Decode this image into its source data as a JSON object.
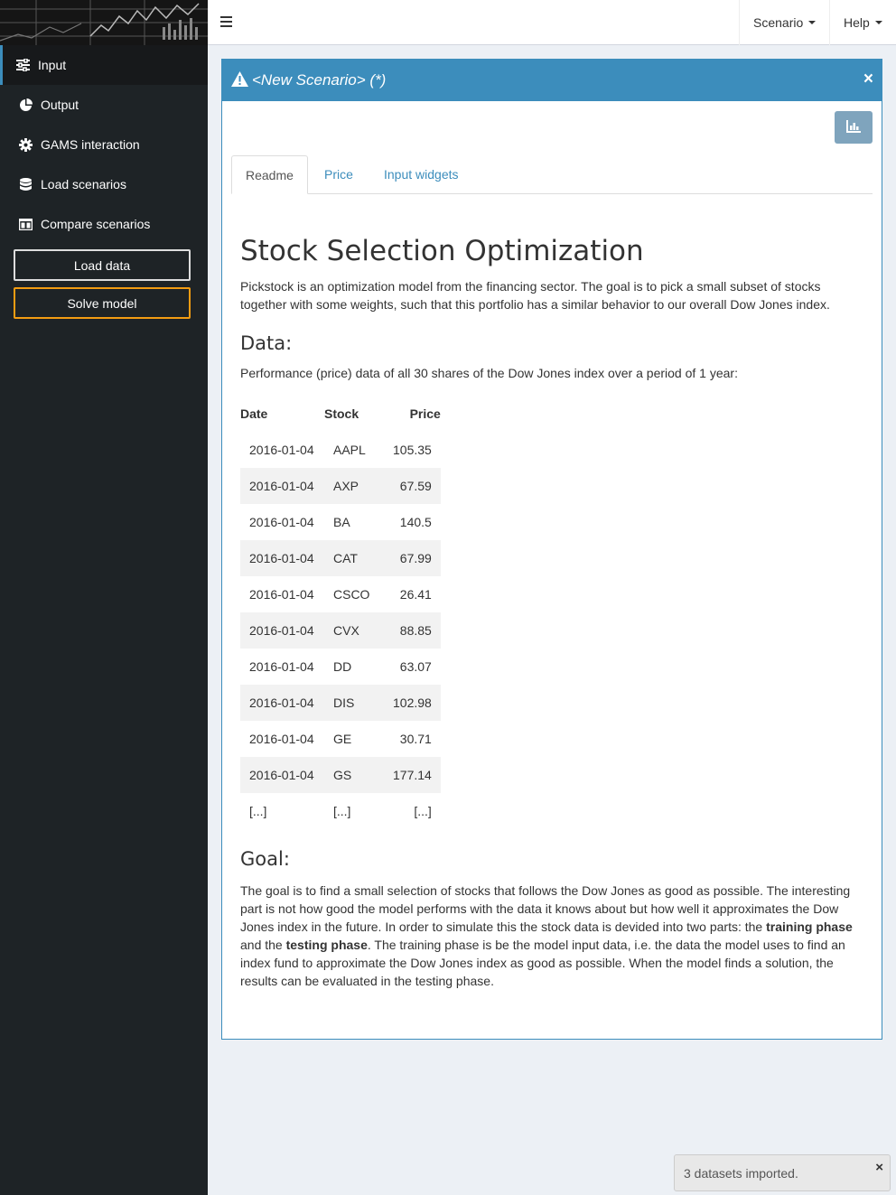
{
  "sidebar": {
    "items": [
      {
        "label": "Input",
        "icon": "sliders-icon"
      },
      {
        "label": "Output",
        "icon": "pie-chart-icon"
      },
      {
        "label": "GAMS interaction",
        "icon": "gear-icon"
      },
      {
        "label": "Load scenarios",
        "icon": "database-icon"
      },
      {
        "label": "Compare scenarios",
        "icon": "columns-icon"
      }
    ],
    "load_data_label": "Load data",
    "solve_model_label": "Solve model"
  },
  "header": {
    "scenario_label": "Scenario",
    "help_label": "Help"
  },
  "box": {
    "title": "<New Scenario> (*)",
    "close_glyph": "×"
  },
  "tabs": [
    "Readme",
    "Price",
    "Input widgets"
  ],
  "readme": {
    "title": "Stock Selection Optimization",
    "intro": "Pickstock is an optimization model from the financing sector. The goal is to pick a small subset of stocks together with some weights, such that this portfolio has a similar behavior to our overall Dow Jones index.",
    "data_heading": "Data:",
    "data_text": "Performance (price) data of all 30 shares of the Dow Jones index over a period of 1 year:",
    "table": {
      "headers": [
        "Date",
        "Stock",
        "Price"
      ],
      "rows": [
        [
          "2016-01-04",
          "AAPL",
          "105.35"
        ],
        [
          "2016-01-04",
          "AXP",
          "67.59"
        ],
        [
          "2016-01-04",
          "BA",
          "140.5"
        ],
        [
          "2016-01-04",
          "CAT",
          "67.99"
        ],
        [
          "2016-01-04",
          "CSCO",
          "26.41"
        ],
        [
          "2016-01-04",
          "CVX",
          "88.85"
        ],
        [
          "2016-01-04",
          "DD",
          "63.07"
        ],
        [
          "2016-01-04",
          "DIS",
          "102.98"
        ],
        [
          "2016-01-04",
          "GE",
          "30.71"
        ],
        [
          "2016-01-04",
          "GS",
          "177.14"
        ],
        [
          "[...]",
          "[...]",
          "[...]"
        ]
      ]
    },
    "goal_heading": "Goal:",
    "goal_text_1": "The goal is to find a small selection of stocks that follows the Dow Jones as good as possible. The interesting part is not how good the model performs with the data it knows about but how well it approximates the Dow Jones index in the future. In order to simulate this the stock data is devided into two parts: the ",
    "goal_bold_1": "training phase",
    "goal_text_2": " and the ",
    "goal_bold_2": "testing phase",
    "goal_text_3": ". The training phase is be the model input data, i.e. the data the model uses to find an index fund to approximate the Dow Jones index as good as possible. When the model finds a solution, the results can be evaluated in the testing phase."
  },
  "toast": {
    "message": "3 datasets imported.",
    "close_glyph": "×"
  },
  "colors": {
    "accent": "#3c8dbc",
    "sidebar_bg": "#1e2326",
    "solve_border": "#f39c12"
  }
}
